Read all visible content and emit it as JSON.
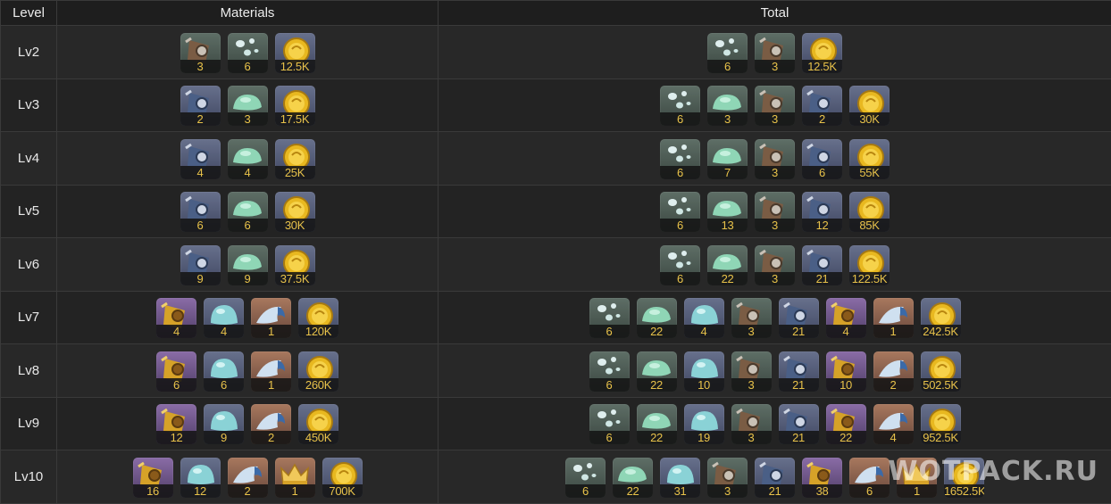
{
  "header": {
    "level": "Level",
    "materials": "Materials",
    "total": "Total"
  },
  "rows": [
    {
      "level": "Lv2",
      "materials": [
        {
          "icon": "scroll-green-icon",
          "count": "3"
        },
        {
          "icon": "slime-drops-icon",
          "count": "6"
        },
        {
          "icon": "coin-icon",
          "count": "12.5K"
        }
      ],
      "total": [
        {
          "icon": "slime-drops-icon",
          "count": "6"
        },
        {
          "icon": "scroll-green-icon",
          "count": "3"
        },
        {
          "icon": "coin-icon",
          "count": "12.5K"
        }
      ]
    },
    {
      "level": "Lv3",
      "materials": [
        {
          "icon": "scroll-blue-icon",
          "count": "2"
        },
        {
          "icon": "slime-green-icon",
          "count": "3"
        },
        {
          "icon": "coin-icon",
          "count": "17.5K"
        }
      ],
      "total": [
        {
          "icon": "slime-drops-icon",
          "count": "6"
        },
        {
          "icon": "slime-green-icon",
          "count": "3"
        },
        {
          "icon": "scroll-green-icon",
          "count": "3"
        },
        {
          "icon": "scroll-blue-icon",
          "count": "2"
        },
        {
          "icon": "coin-icon",
          "count": "30K"
        }
      ]
    },
    {
      "level": "Lv4",
      "materials": [
        {
          "icon": "scroll-blue-icon",
          "count": "4"
        },
        {
          "icon": "slime-green-icon",
          "count": "4"
        },
        {
          "icon": "coin-icon",
          "count": "25K"
        }
      ],
      "total": [
        {
          "icon": "slime-drops-icon",
          "count": "6"
        },
        {
          "icon": "slime-green-icon",
          "count": "7"
        },
        {
          "icon": "scroll-green-icon",
          "count": "3"
        },
        {
          "icon": "scroll-blue-icon",
          "count": "6"
        },
        {
          "icon": "coin-icon",
          "count": "55K"
        }
      ]
    },
    {
      "level": "Lv5",
      "materials": [
        {
          "icon": "scroll-blue-icon",
          "count": "6"
        },
        {
          "icon": "slime-green-icon",
          "count": "6"
        },
        {
          "icon": "coin-icon",
          "count": "30K"
        }
      ],
      "total": [
        {
          "icon": "slime-drops-icon",
          "count": "6"
        },
        {
          "icon": "slime-green-icon",
          "count": "13"
        },
        {
          "icon": "scroll-green-icon",
          "count": "3"
        },
        {
          "icon": "scroll-blue-icon",
          "count": "12"
        },
        {
          "icon": "coin-icon",
          "count": "85K"
        }
      ]
    },
    {
      "level": "Lv6",
      "materials": [
        {
          "icon": "scroll-blue-icon",
          "count": "9"
        },
        {
          "icon": "slime-green-icon",
          "count": "9"
        },
        {
          "icon": "coin-icon",
          "count": "37.5K"
        }
      ],
      "total": [
        {
          "icon": "slime-drops-icon",
          "count": "6"
        },
        {
          "icon": "slime-green-icon",
          "count": "22"
        },
        {
          "icon": "scroll-green-icon",
          "count": "3"
        },
        {
          "icon": "scroll-blue-icon",
          "count": "21"
        },
        {
          "icon": "coin-icon",
          "count": "122.5K"
        }
      ]
    },
    {
      "level": "Lv7",
      "materials": [
        {
          "icon": "scroll-purple-icon",
          "count": "4"
        },
        {
          "icon": "slime-blue-icon",
          "count": "4"
        },
        {
          "icon": "wave-orange-icon",
          "count": "1"
        },
        {
          "icon": "coin-icon",
          "count": "120K"
        }
      ],
      "total": [
        {
          "icon": "slime-drops-icon",
          "count": "6"
        },
        {
          "icon": "slime-green-icon",
          "count": "22"
        },
        {
          "icon": "slime-blue-icon",
          "count": "4"
        },
        {
          "icon": "scroll-green-icon",
          "count": "3"
        },
        {
          "icon": "scroll-blue-icon",
          "count": "21"
        },
        {
          "icon": "scroll-purple-icon",
          "count": "4"
        },
        {
          "icon": "wave-orange-icon",
          "count": "1"
        },
        {
          "icon": "coin-icon",
          "count": "242.5K"
        }
      ]
    },
    {
      "level": "Lv8",
      "materials": [
        {
          "icon": "scroll-purple-icon",
          "count": "6"
        },
        {
          "icon": "slime-blue-icon",
          "count": "6"
        },
        {
          "icon": "wave-orange-icon",
          "count": "1"
        },
        {
          "icon": "coin-icon",
          "count": "260K"
        }
      ],
      "total": [
        {
          "icon": "slime-drops-icon",
          "count": "6"
        },
        {
          "icon": "slime-green-icon",
          "count": "22"
        },
        {
          "icon": "slime-blue-icon",
          "count": "10"
        },
        {
          "icon": "scroll-green-icon",
          "count": "3"
        },
        {
          "icon": "scroll-blue-icon",
          "count": "21"
        },
        {
          "icon": "scroll-purple-icon",
          "count": "10"
        },
        {
          "icon": "wave-orange-icon",
          "count": "2"
        },
        {
          "icon": "coin-icon",
          "count": "502.5K"
        }
      ]
    },
    {
      "level": "Lv9",
      "materials": [
        {
          "icon": "scroll-purple-icon",
          "count": "12"
        },
        {
          "icon": "slime-blue-icon",
          "count": "9"
        },
        {
          "icon": "wave-orange-icon",
          "count": "2"
        },
        {
          "icon": "coin-icon",
          "count": "450K"
        }
      ],
      "total": [
        {
          "icon": "slime-drops-icon",
          "count": "6"
        },
        {
          "icon": "slime-green-icon",
          "count": "22"
        },
        {
          "icon": "slime-blue-icon",
          "count": "19"
        },
        {
          "icon": "scroll-green-icon",
          "count": "3"
        },
        {
          "icon": "scroll-blue-icon",
          "count": "21"
        },
        {
          "icon": "scroll-purple-icon",
          "count": "22"
        },
        {
          "icon": "wave-orange-icon",
          "count": "4"
        },
        {
          "icon": "coin-icon",
          "count": "952.5K"
        }
      ]
    },
    {
      "level": "Lv10",
      "materials": [
        {
          "icon": "scroll-purple-icon",
          "count": "16"
        },
        {
          "icon": "slime-blue-icon",
          "count": "12"
        },
        {
          "icon": "wave-orange-icon",
          "count": "2"
        },
        {
          "icon": "crown-icon",
          "count": "1"
        },
        {
          "icon": "coin-icon",
          "count": "700K"
        }
      ],
      "total": [
        {
          "icon": "slime-drops-icon",
          "count": "6"
        },
        {
          "icon": "slime-green-icon",
          "count": "22"
        },
        {
          "icon": "slime-blue-icon",
          "count": "31"
        },
        {
          "icon": "scroll-green-icon",
          "count": "3"
        },
        {
          "icon": "scroll-blue-icon",
          "count": "21"
        },
        {
          "icon": "scroll-purple-icon",
          "count": "38"
        },
        {
          "icon": "wave-orange-icon",
          "count": "6"
        },
        {
          "icon": "crown-icon",
          "count": "1"
        },
        {
          "icon": "coin-icon",
          "count": "1652.5K"
        }
      ]
    }
  ],
  "watermark": "WOTPACK.RU",
  "colors": {
    "count_text": "#e8c24a",
    "row_odd": "#282828",
    "row_even": "#232323",
    "border": "#3a3a3a"
  }
}
